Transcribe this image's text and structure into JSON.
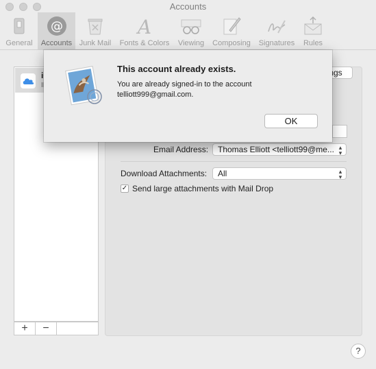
{
  "window": {
    "title": "Accounts"
  },
  "toolbar": {
    "items": [
      {
        "label": "General",
        "icon": "general-switch-icon"
      },
      {
        "label": "Accounts",
        "icon": "at-sign-icon",
        "selected": true
      },
      {
        "label": "Junk Mail",
        "icon": "junk-trash-icon"
      },
      {
        "label": "Fonts & Colors",
        "icon": "font-a-icon"
      },
      {
        "label": "Viewing",
        "icon": "glasses-icon"
      },
      {
        "label": "Composing",
        "icon": "pencil-edit-icon"
      },
      {
        "label": "Signatures",
        "icon": "signature-icon"
      },
      {
        "label": "Rules",
        "icon": "rules-envelope-icon"
      }
    ]
  },
  "accounts": {
    "items": [
      {
        "name": "iC",
        "type": "IM",
        "icon": "icloud-icon"
      }
    ],
    "add_label": "+",
    "remove_label": "−"
  },
  "panel": {
    "tab_label": "ngs",
    "email_address_label": "Email Address:",
    "email_address_value": "Thomas Elliott <telliott99@me...",
    "download_attachments_label": "Download Attachments:",
    "download_attachments_value": "All",
    "mail_drop_label": "Send large attachments with Mail Drop",
    "mail_drop_checked": true,
    "check_mark": "✓"
  },
  "sheet": {
    "heading": "This account already exists.",
    "message_line1": "You are already signed-in to the account",
    "message_line2": "telliott999@gmail.com.",
    "ok_label": "OK",
    "icon": "mail-stamp-icon"
  },
  "help": {
    "label": "?"
  }
}
